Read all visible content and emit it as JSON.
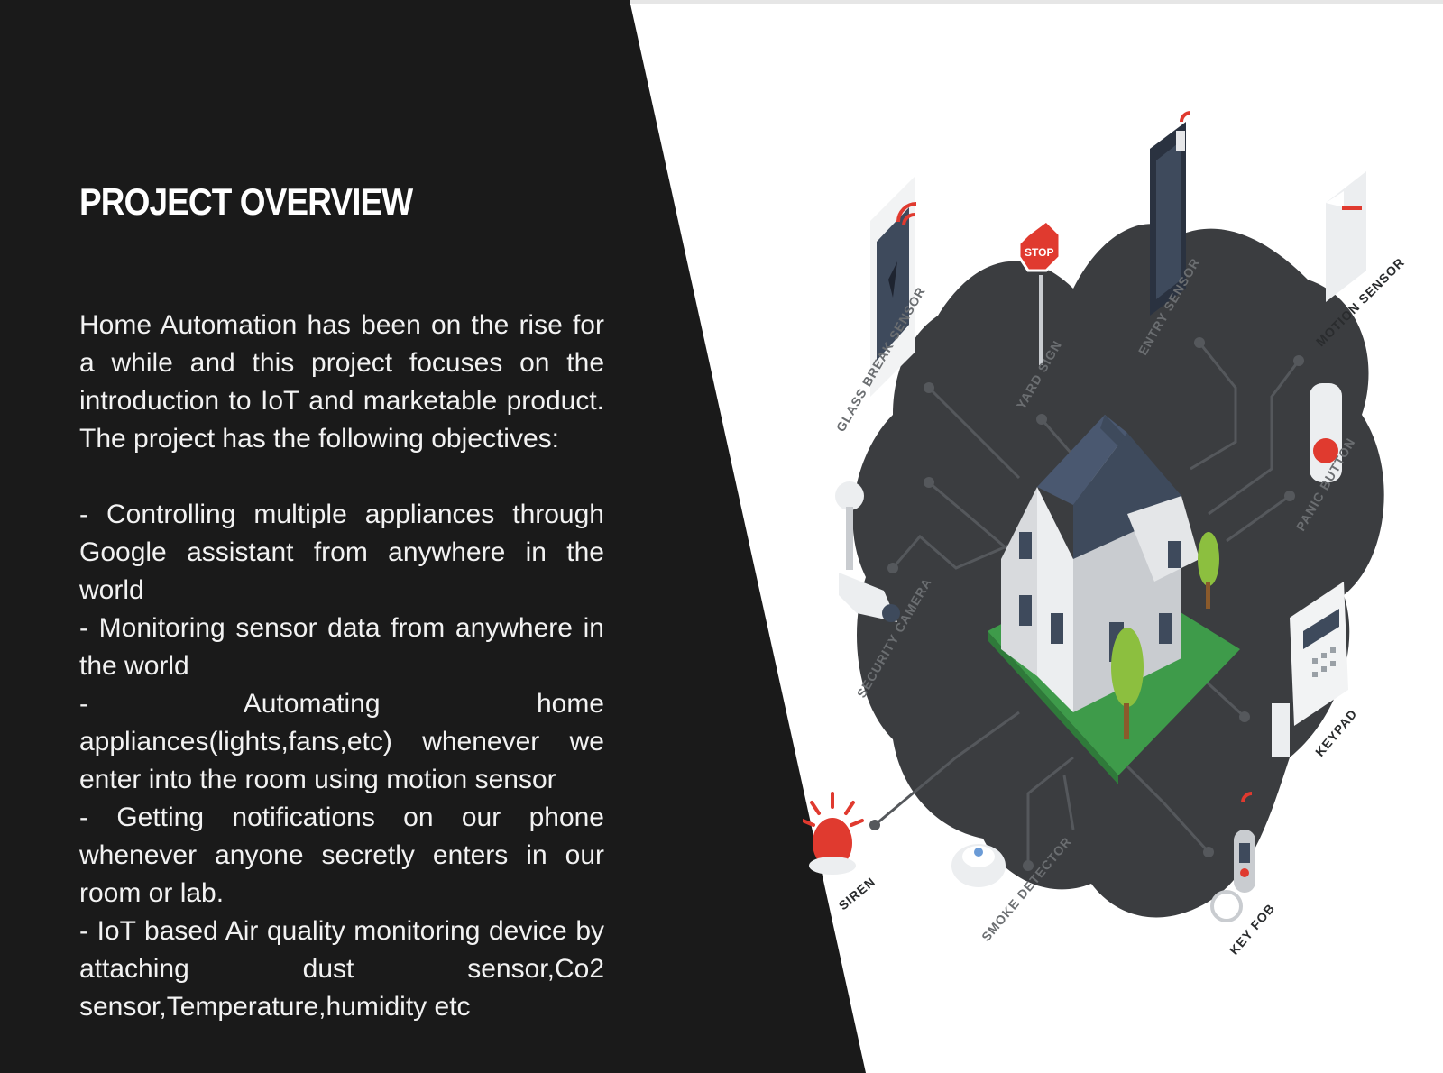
{
  "overview": {
    "title": "PROJECT OVERVIEW",
    "intro": "Home Automation has been on the rise for a while and this project focuses on the introduction to IoT and marketable product. The project has the following objectives:",
    "objectives": [
      "- Controlling multiple appliances through Google assistant from anywhere in the world",
      "- Monitoring sensor data from anywhere in the world",
      "- Automating home appliances(lights,fans,etc) whenever we enter into the room using motion sensor",
      "- Getting notifications on our phone whenever anyone secretly enters in our room or lab.",
      "- IoT based Air quality monitoring device by attaching dust sensor,Co2 sensor,Temperature,humidity etc"
    ]
  },
  "illustration": {
    "labels": {
      "glass_break": "GLASS BREAK SENSOR",
      "yard_sign": "YARD SIGN",
      "entry_sensor": "ENTRY SENSOR",
      "motion_sensor": "MOTION SENSOR",
      "panic_button": "PANIC BUTTON",
      "security_camera": "SECURITY CAMERA",
      "keypad": "KEYPAD",
      "siren": "SIREN",
      "smoke_detector": "SMOKE DETECTOR",
      "key_fob": "KEY FOB"
    },
    "stop_sign_text": "STOP",
    "colors": {
      "blob": "#3b3d40",
      "roof": "#3e4a5c",
      "lawn": "#3e9b4a",
      "alert_red": "#e03a2f",
      "panel_dark": "#1a1a1a"
    }
  }
}
